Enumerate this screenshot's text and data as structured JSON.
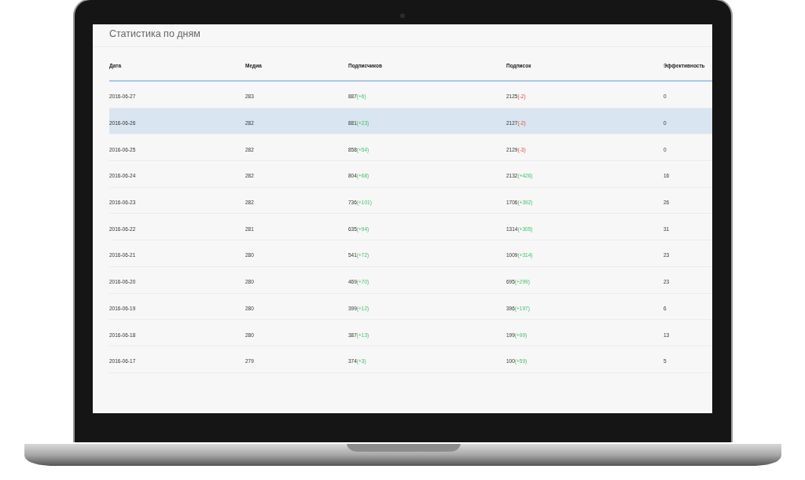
{
  "title": "Статистика по дням",
  "table": {
    "columns": [
      "Дата",
      "Медиа",
      "Подписчиков",
      "Подписок",
      "Эффективность"
    ],
    "rows": [
      {
        "selected": false,
        "date": "2016-06-27",
        "media": "283",
        "subscribers": {
          "value": "887",
          "change": "(+6)",
          "kind": "up"
        },
        "subscriptions": {
          "value": "2125",
          "change": "(-2)",
          "kind": "down"
        },
        "efficiency": "0"
      },
      {
        "selected": true,
        "date": "2016-06-26",
        "media": "282",
        "subscribers": {
          "value": "881",
          "change": "(+23)",
          "kind": "up"
        },
        "subscriptions": {
          "value": "2127",
          "change": "(-2)",
          "kind": "down"
        },
        "efficiency": "0"
      },
      {
        "selected": false,
        "date": "2016-06-25",
        "media": "282",
        "subscribers": {
          "value": "858",
          "change": "(+54)",
          "kind": "up"
        },
        "subscriptions": {
          "value": "2129",
          "change": "(-3)",
          "kind": "down"
        },
        "efficiency": "0"
      },
      {
        "selected": false,
        "date": "2016-06-24",
        "media": "282",
        "subscribers": {
          "value": "804",
          "change": "(+68)",
          "kind": "up"
        },
        "subscriptions": {
          "value": "2132",
          "change": "(+426)",
          "kind": "up"
        },
        "efficiency": "16"
      },
      {
        "selected": false,
        "date": "2016-06-23",
        "media": "282",
        "subscribers": {
          "value": "736",
          "change": "(+101)",
          "kind": "up"
        },
        "subscriptions": {
          "value": "1706",
          "change": "(+392)",
          "kind": "up"
        },
        "efficiency": "26"
      },
      {
        "selected": false,
        "date": "2016-06-22",
        "media": "281",
        "subscribers": {
          "value": "635",
          "change": "(+94)",
          "kind": "up"
        },
        "subscriptions": {
          "value": "1314",
          "change": "(+305)",
          "kind": "up"
        },
        "efficiency": "31"
      },
      {
        "selected": false,
        "date": "2016-06-21",
        "media": "280",
        "subscribers": {
          "value": "541",
          "change": "(+72)",
          "kind": "up"
        },
        "subscriptions": {
          "value": "1009",
          "change": "(+314)",
          "kind": "up"
        },
        "efficiency": "23"
      },
      {
        "selected": false,
        "date": "2016-06-20",
        "media": "280",
        "subscribers": {
          "value": "469",
          "change": "(+70)",
          "kind": "up"
        },
        "subscriptions": {
          "value": "695",
          "change": "(+299)",
          "kind": "up"
        },
        "efficiency": "23"
      },
      {
        "selected": false,
        "date": "2016-06-19",
        "media": "280",
        "subscribers": {
          "value": "399",
          "change": "(+12)",
          "kind": "up"
        },
        "subscriptions": {
          "value": "396",
          "change": "(+197)",
          "kind": "up"
        },
        "efficiency": "6"
      },
      {
        "selected": false,
        "date": "2016-06-18",
        "media": "280",
        "subscribers": {
          "value": "387",
          "change": "(+13)",
          "kind": "up"
        },
        "subscriptions": {
          "value": "199",
          "change": "(+99)",
          "kind": "up"
        },
        "efficiency": "13"
      },
      {
        "selected": false,
        "date": "2016-06-17",
        "media": "279",
        "subscribers": {
          "value": "374",
          "change": "(+3)",
          "kind": "up"
        },
        "subscriptions": {
          "value": "100",
          "change": "(+59)",
          "kind": "up"
        },
        "efficiency": "5"
      }
    ]
  }
}
